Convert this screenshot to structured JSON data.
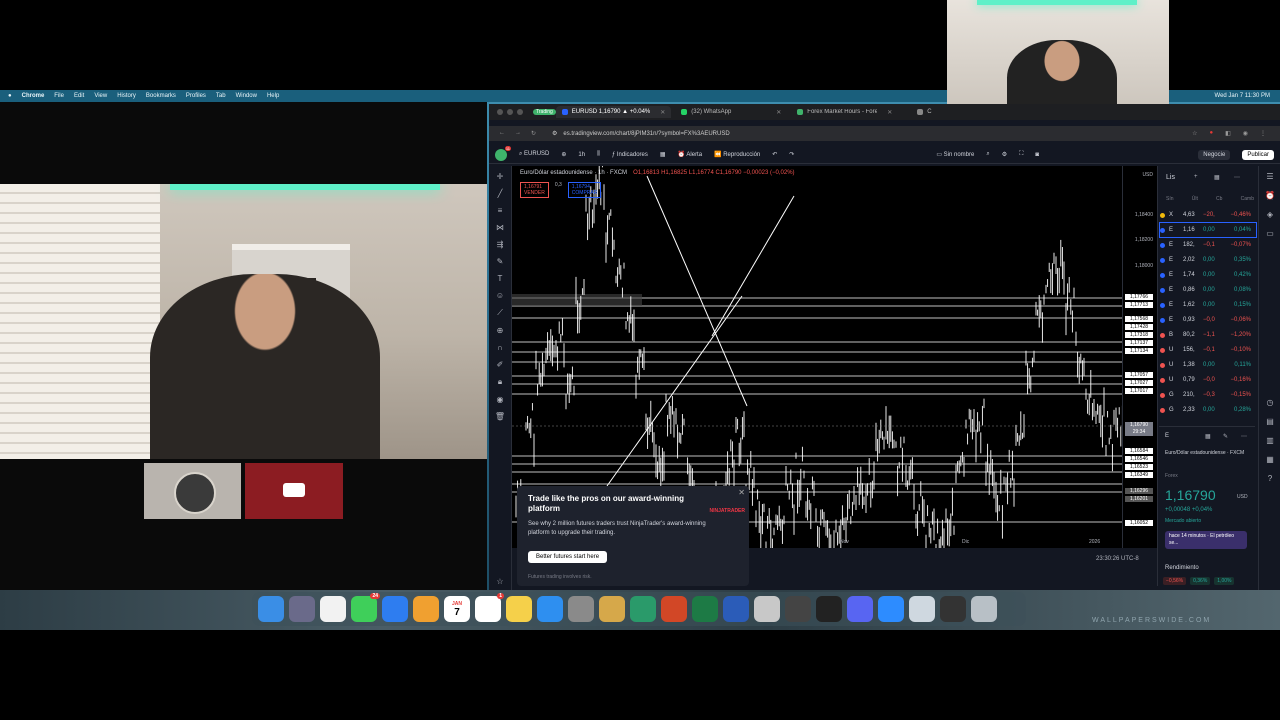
{
  "menubar": {
    "app": "Chrome",
    "items": [
      "File",
      "Edit",
      "View",
      "History",
      "Bookmarks",
      "Profiles",
      "Tab",
      "Window",
      "Help"
    ],
    "clock": "Wed Jan 7  11:30 PM",
    "gemini": "Gemini"
  },
  "tabs": [
    {
      "group": "Trading",
      "label": "EURUSD 1,16790 ▲ +0.04%",
      "active": true,
      "favicon": "#2962ff"
    },
    {
      "label": "(32) WhatsApp",
      "active": false,
      "favicon": "#25d366"
    },
    {
      "label": "Forex Market Hours - Forex M",
      "active": false,
      "favicon": "#3fb36b"
    },
    {
      "label": "C",
      "active": false,
      "favicon": "#888888"
    }
  ],
  "address": {
    "url": "es.tradingview.com/chart/8jPIM31n/?symbol=FX%3AEURUSD"
  },
  "tvbar": {
    "avatar_badge": "11",
    "symbol": "EURUSD",
    "interval": "1h",
    "indicators": "Indicadores",
    "alert": "Alerta",
    "replay": "Reproducción",
    "layout_name": "Sin nombre",
    "trade": "Negocie",
    "publish": "Publicar"
  },
  "chart_legend": {
    "title": "Euro/Dólar estadounidense · 1h · FXCM",
    "ohlc": "O1,16813 H1,16825 L1,16774 C1,16790 −0,00023 (−0,02%)",
    "sell_price": "1,16791",
    "sell_label": "VENDER",
    "spread": "0,3",
    "buy_price": "1,16794",
    "buy_label": "COMPRAR"
  },
  "price_scale": {
    "currency": "USD",
    "labels": [
      "1,18400",
      "1,18200",
      "1,18000",
      "1,17600",
      "1,16800",
      "1,16052"
    ],
    "level_marks": [
      "1,17568",
      "1,17428",
      "1,17318",
      "1,17137",
      "1,17134",
      "1,17057",
      "1,17027",
      "1,17017",
      "1,16584",
      "1,16546",
      "1,16523",
      "1,16349",
      "1,16296",
      "1,16201"
    ],
    "current": "1,16790",
    "current_time": "29:34",
    "top_mark": "1,17766",
    "mark2": "1,17713"
  },
  "time_axis": {
    "labels": [
      "Nov",
      "Dic",
      "2026"
    ],
    "clock": "23:30:26 UTC-8"
  },
  "promo": {
    "title": "Trade like the pros on our award-winning platform",
    "brand": "NINJATRADER",
    "desc": "See why 2 million futures traders trust NinjaTrader's award-winning platform to upgrade their trading.",
    "cta": "Better futures start here",
    "risk": "Futures trading involves risk."
  },
  "watchlist": {
    "header": "Lis",
    "cols": [
      "Sín",
      "Últ",
      "Cb",
      "Camb"
    ],
    "rows": [
      {
        "sym": "X",
        "last": "4,63",
        "chg": "−20,",
        "pct": "−0,46%",
        "dir": "neg",
        "flag": "#f0b90b"
      },
      {
        "sym": "E",
        "last": "1,16",
        "chg": "0,00",
        "pct": "0,04%",
        "dir": "pos",
        "flag": "#2962ff"
      },
      {
        "sym": "E",
        "last": "182,",
        "chg": "−0,1",
        "pct": "−0,07%",
        "dir": "neg",
        "flag": "#2962ff"
      },
      {
        "sym": "E",
        "last": "2,02",
        "chg": "0,00",
        "pct": "0,35%",
        "dir": "pos",
        "flag": "#2962ff"
      },
      {
        "sym": "E",
        "last": "1,74",
        "chg": "0,00",
        "pct": "0,42%",
        "dir": "pos",
        "flag": "#2962ff"
      },
      {
        "sym": "E",
        "last": "0,86",
        "chg": "0,00",
        "pct": "0,08%",
        "dir": "pos",
        "flag": "#2962ff"
      },
      {
        "sym": "E",
        "last": "1,62",
        "chg": "0,00",
        "pct": "0,15%",
        "dir": "pos",
        "flag": "#2962ff"
      },
      {
        "sym": "E",
        "last": "0,93",
        "chg": "−0,0",
        "pct": "−0,06%",
        "dir": "neg",
        "flag": "#2962ff"
      },
      {
        "sym": "B",
        "last": "80,2",
        "chg": "−1,1",
        "pct": "−1,20%",
        "dir": "neg",
        "flag": "#ef5350"
      },
      {
        "sym": "U",
        "last": "156,",
        "chg": "−0,1",
        "pct": "−0,10%",
        "dir": "neg",
        "flag": "#ef5350"
      },
      {
        "sym": "U",
        "last": "1,38",
        "chg": "0,00",
        "pct": "0,11%",
        "dir": "pos",
        "flag": "#ef5350"
      },
      {
        "sym": "U",
        "last": "0,79",
        "chg": "−0,0",
        "pct": "−0,16%",
        "dir": "neg",
        "flag": "#ef5350"
      },
      {
        "sym": "G",
        "last": "210,",
        "chg": "−0,3",
        "pct": "−0,15%",
        "dir": "neg",
        "flag": "#ef5350"
      },
      {
        "sym": "G",
        "last": "2,33",
        "chg": "0,00",
        "pct": "0,28%",
        "dir": "pos",
        "flag": "#ef5350"
      }
    ]
  },
  "detail": {
    "sym": "E",
    "name": "Euro/Dólar estadounidense · FXCM",
    "type": "Forex",
    "price": "1,16790",
    "currency": "USD",
    "change": "+0,00048 +0,04%",
    "market": "Mercado abierto",
    "news": "hace 14 minutos · El petróleo se...",
    "perf_title": "Rendimiento",
    "perf": [
      "−0,56%",
      "0,36%",
      "1,00%"
    ]
  },
  "dock_icons": [
    "finder-icon",
    "launchpad-icon",
    "chrome-icon",
    "messages-icon",
    "mail-icon",
    "photos-icon",
    "calendar-icon",
    "reminders-icon",
    "notes-icon",
    "appstore-icon",
    "settings-icon",
    "books-icon",
    "metatrader-icon",
    "powerpoint-icon",
    "excel-icon",
    "word-icon",
    "pdf-icon",
    "vpn-icon",
    "terminal-icon",
    "discord-icon",
    "zoom-icon",
    "preview-icon",
    "screenshot-icon",
    "trash-icon"
  ],
  "dock_calendar": {
    "month": "JAN",
    "day": "7"
  },
  "dock_reminders_badge": "1",
  "dock_messages_badge": "24",
  "watermark": "WALLPAPERSWIDE.COM",
  "colors": {
    "up": "#26a69a",
    "down": "#ef5350",
    "accent": "#2962ff",
    "bg": "#131722"
  }
}
